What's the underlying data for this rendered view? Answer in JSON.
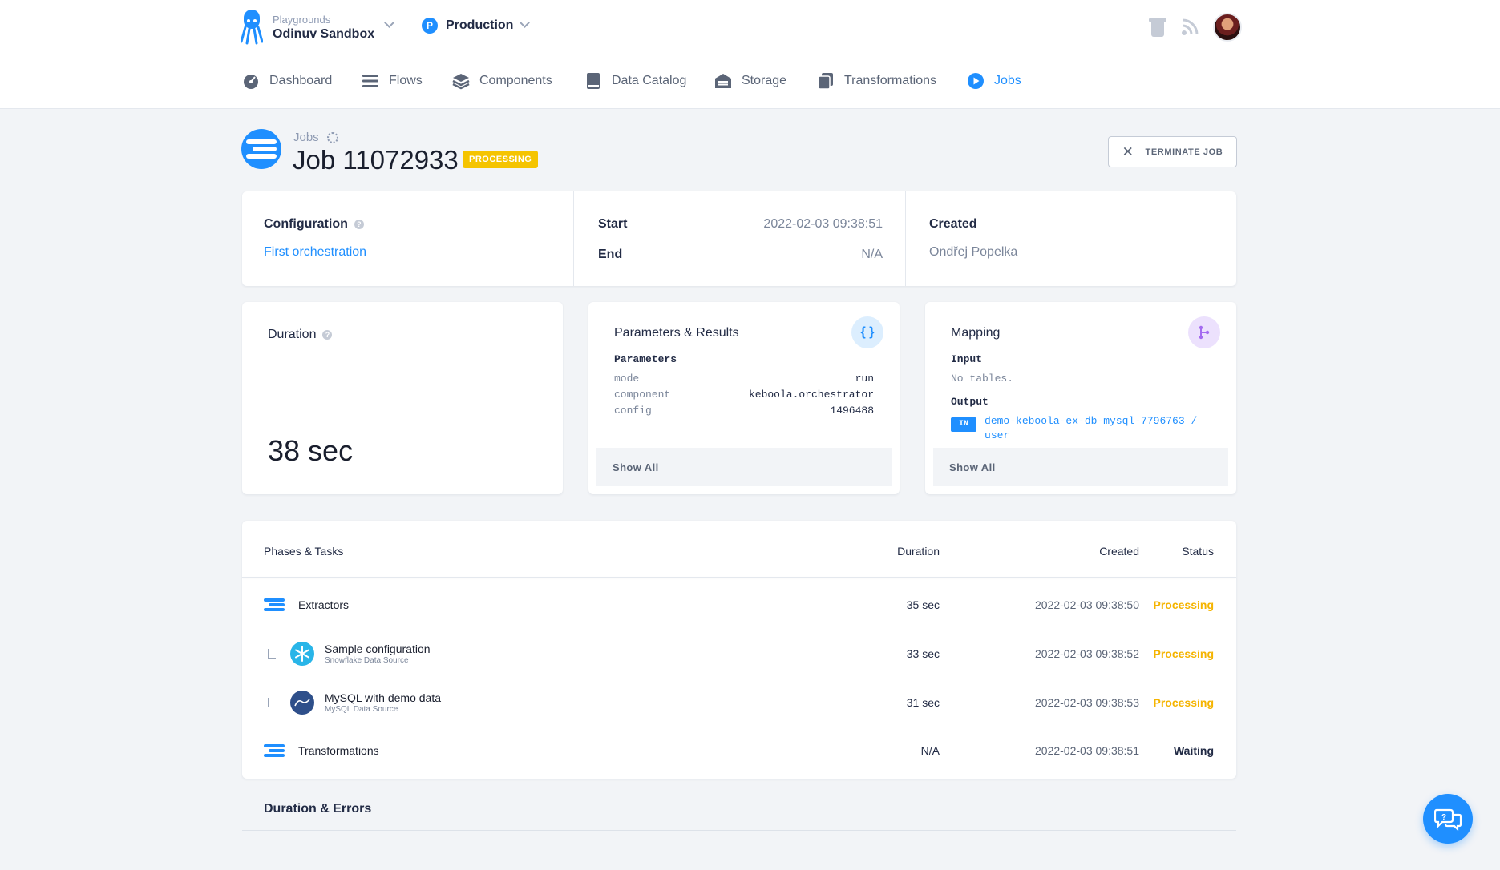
{
  "project": {
    "label": "Playgrounds",
    "name": "Odinuv Sandbox"
  },
  "branch": {
    "letter": "P",
    "name": "Production"
  },
  "nav": {
    "dashboard": "Dashboard",
    "flows": "Flows",
    "components": "Components",
    "data_catalog": "Data Catalog",
    "storage": "Storage",
    "transformations": "Transformations",
    "jobs": "Jobs"
  },
  "header": {
    "breadcrumb": "Jobs",
    "title": "Job 11072933",
    "status_badge": "PROCESSING",
    "terminate_label": "TERMINATE JOB"
  },
  "info": {
    "configuration_label": "Configuration",
    "configuration_value": "First orchestration",
    "start_label": "Start",
    "start_value": "2022-02-03 09:38:51",
    "end_label": "End",
    "end_value": "N/A",
    "created_label": "Created",
    "created_value": "Ondřej Popelka"
  },
  "duration_card": {
    "label": "Duration",
    "value": "38 sec"
  },
  "params_card": {
    "title": "Parameters & Results",
    "section": "Parameters",
    "rows": [
      {
        "key": "mode",
        "value": "run"
      },
      {
        "key": "component",
        "value": "keboola.orchestrator"
      },
      {
        "key": "config",
        "value": "1496488"
      }
    ],
    "show_all": "Show All"
  },
  "mapping_card": {
    "title": "Mapping",
    "input_label": "Input",
    "input_value": "No tables.",
    "output_label": "Output",
    "output_badge": "IN",
    "output_link": "demo-keboola-ex-db-mysql-7796763 / user",
    "show_all": "Show All"
  },
  "tasks_table": {
    "headers": {
      "name": "Phases & Tasks",
      "duration": "Duration",
      "created": "Created",
      "status": "Status"
    },
    "rows": [
      {
        "type": "phase",
        "name": "Extractors",
        "sub": "",
        "duration": "35 sec",
        "created": "2022-02-03 09:38:50",
        "status": "Processing"
      },
      {
        "type": "task",
        "icon": "snowflake-icon",
        "name": "Sample configuration",
        "sub": "Snowflake Data Source",
        "duration": "33 sec",
        "created": "2022-02-03 09:38:52",
        "status": "Processing"
      },
      {
        "type": "task",
        "icon": "mysql-icon",
        "name": "MySQL with demo data",
        "sub": "MySQL Data Source",
        "duration": "31 sec",
        "created": "2022-02-03 09:38:53",
        "status": "Processing"
      },
      {
        "type": "phase",
        "name": "Transformations",
        "sub": "",
        "duration": "N/A",
        "created": "2022-02-03 09:38:51",
        "status": "Waiting"
      }
    ]
  },
  "duration_errors_title": "Duration & Errors",
  "colors": {
    "accent": "#1f8fff",
    "processing": "#f5b400",
    "mapping": "#a46bf0"
  }
}
